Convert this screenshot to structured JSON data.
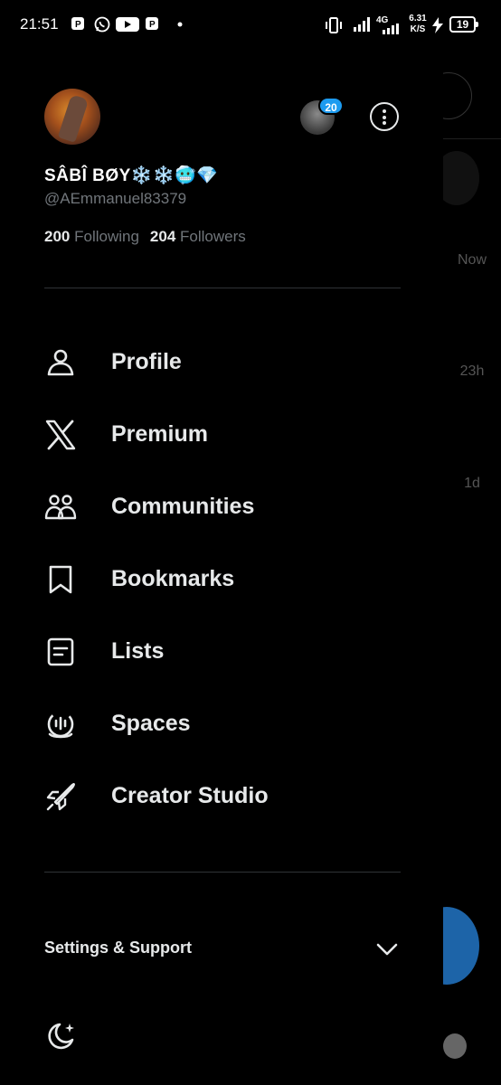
{
  "status_bar": {
    "time": "21:51",
    "network": "4G",
    "speed_value": "6.31",
    "speed_unit": "K/S",
    "battery": "19"
  },
  "background": {
    "times": [
      "Now",
      "23h",
      "1d"
    ]
  },
  "profile": {
    "display_name": "SÂBÎ BØY❄️❄️🥶💎",
    "handle": "@AEmmanuel83379",
    "following_count": "200",
    "following_label": "Following",
    "followers_count": "204",
    "followers_label": "Followers",
    "alt_account_badge": "20"
  },
  "menu": {
    "items": [
      {
        "label": "Profile",
        "icon": "person-icon"
      },
      {
        "label": "Premium",
        "icon": "x-logo-icon"
      },
      {
        "label": "Communities",
        "icon": "communities-icon"
      },
      {
        "label": "Bookmarks",
        "icon": "bookmark-icon"
      },
      {
        "label": "Lists",
        "icon": "list-icon"
      },
      {
        "label": "Spaces",
        "icon": "spaces-icon"
      },
      {
        "label": "Creator Studio",
        "icon": "rocket-icon"
      }
    ]
  },
  "footer": {
    "settings_label": "Settings & Support"
  },
  "colors": {
    "background": "#000000",
    "text_primary": "#e7e9ea",
    "text_secondary": "#71767b",
    "accent": "#1d9bf0",
    "divider": "#2f3336"
  }
}
